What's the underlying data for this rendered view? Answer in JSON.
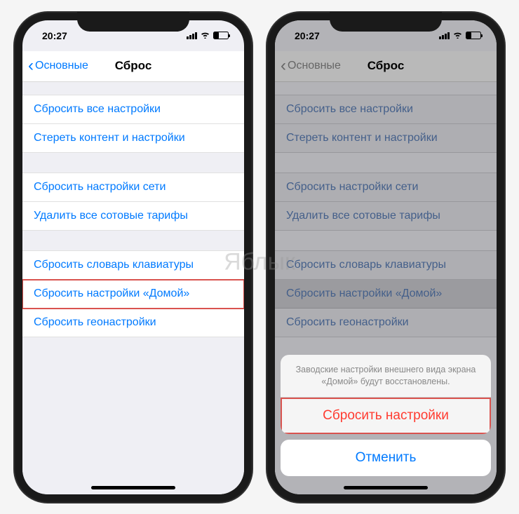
{
  "status": {
    "time": "20:27"
  },
  "nav": {
    "back": "Основные",
    "title": "Сброс"
  },
  "groups": [
    [
      "Сбросить все настройки",
      "Стереть контент и настройки"
    ],
    [
      "Сбросить настройки сети",
      "Удалить все сотовые тарифы"
    ],
    [
      "Сбросить словарь клавиатуры",
      "Сбросить настройки «Домой»",
      "Сбросить геонастройки"
    ]
  ],
  "highlighted_item": "Сбросить настройки «Домой»",
  "sheet": {
    "message": "Заводские настройки внешнего вида экрана «Домой» будут восстановлены.",
    "confirm": "Сбросить настройки",
    "cancel": "Отменить"
  },
  "watermark": "Яблык"
}
